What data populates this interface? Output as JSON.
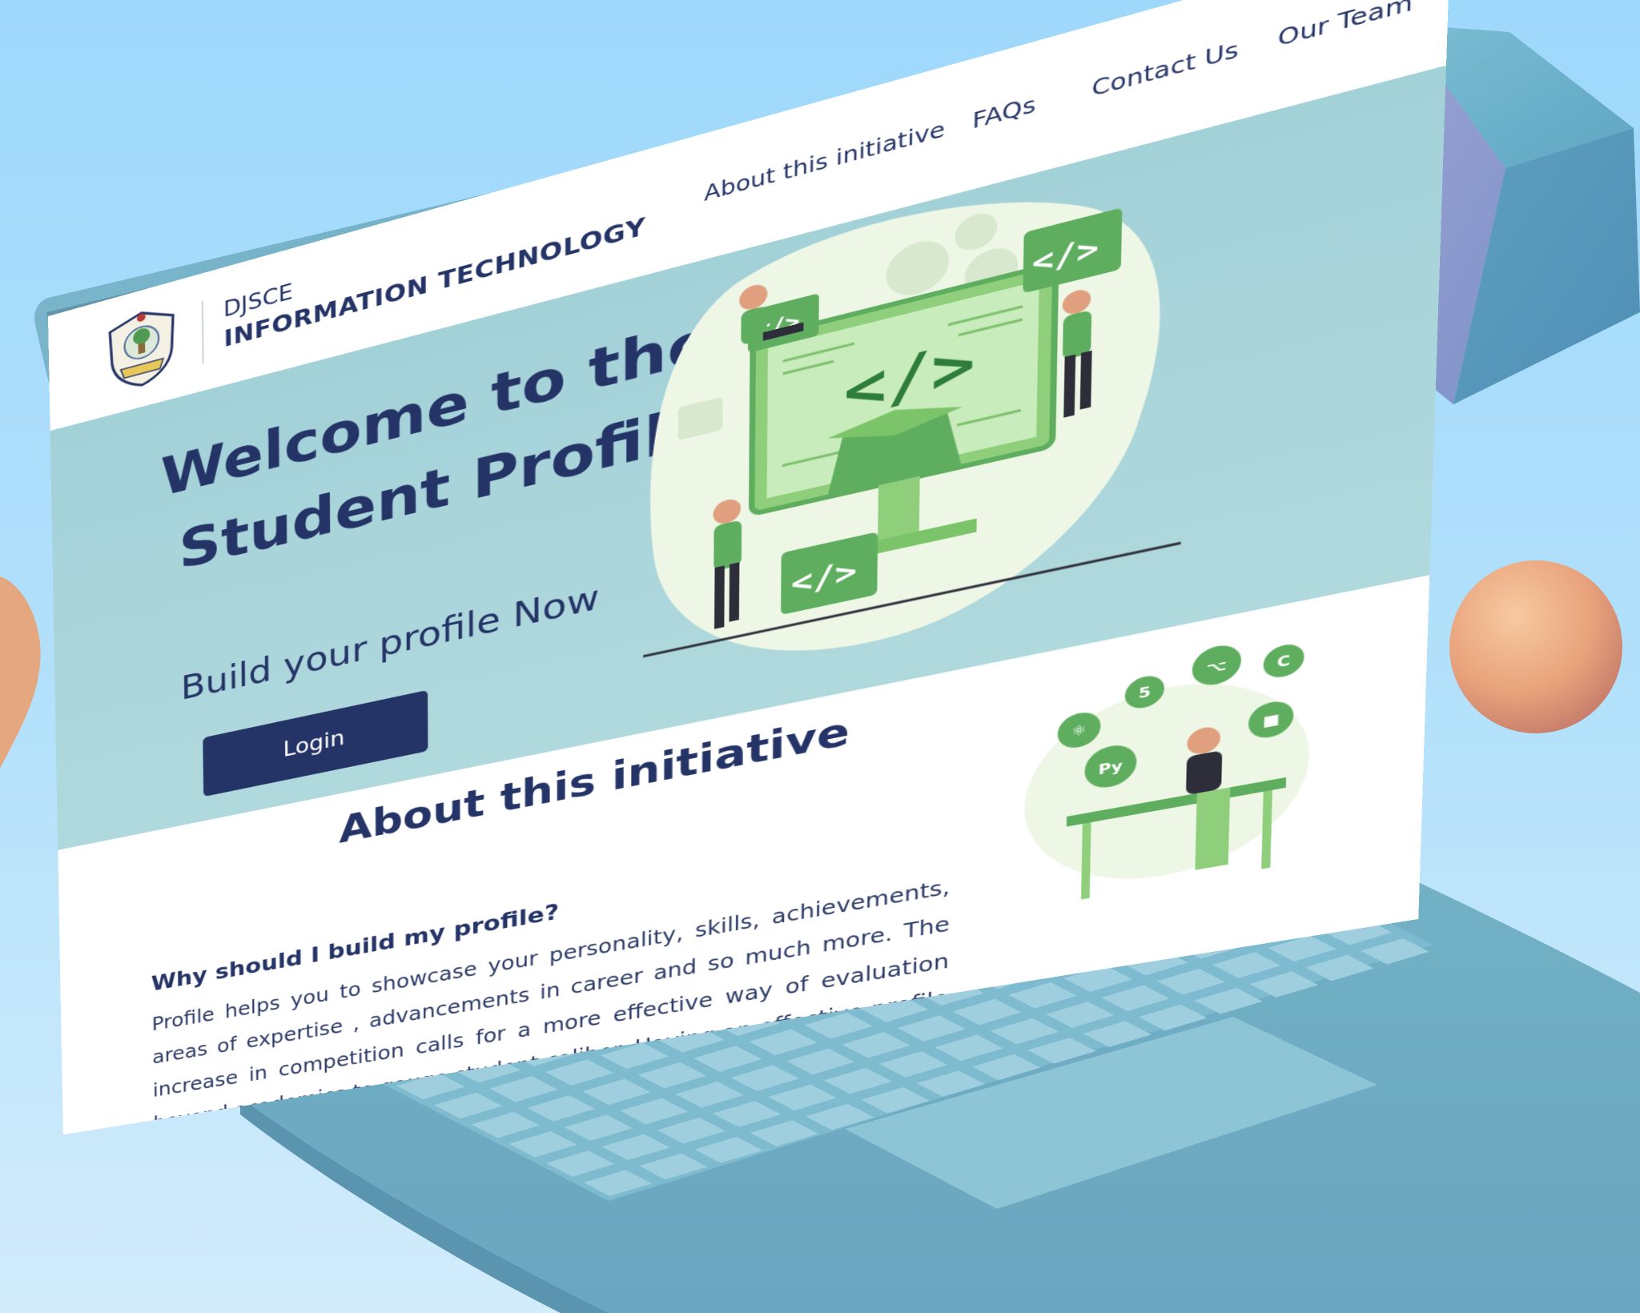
{
  "site": {
    "brand_top": "DJSCE",
    "brand_main": "INFORMATION TECHNOLOGY"
  },
  "nav": {
    "items": [
      {
        "label": "About this initiative"
      },
      {
        "label": "FAQs"
      },
      {
        "label": "Contact Us"
      },
      {
        "label": "Our Team"
      }
    ]
  },
  "hero": {
    "title_line1": "Welcome to the",
    "title_line2": "Student Profile Portal",
    "subtitle": "Build your profile Now",
    "login_label": "Login"
  },
  "about": {
    "title": "About this initiative",
    "question": "Why should I build my profile?",
    "paragraph": "Profile helps you to showcase your personality, skills, achievements, areas of expertise , advancements in career and so much more. The increase in competition calls for a more effective way of evaluation beyond academics to gauge student caliber. Having an effective profile helps employers/teachers to know you better and help you find relevant opportunities."
  },
  "colors": {
    "navy": "#253466",
    "hero_bg": "#a9d4da",
    "laptop_body": "#6eaec4",
    "illustration_green": "#5fae5f"
  },
  "icons": {
    "hero_illustration": "coding-team-illustration",
    "about_illustration": "developer-tech-icons-illustration"
  }
}
